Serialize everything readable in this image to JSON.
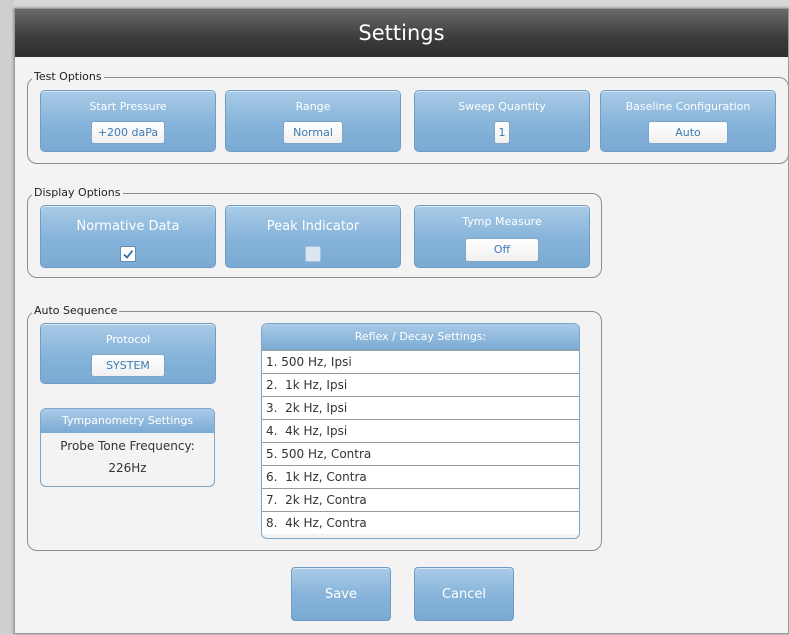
{
  "window": {
    "title": "Settings"
  },
  "test_options": {
    "label": "Test Options",
    "tiles": [
      {
        "title": "Start Pressure",
        "value": "+200 daPa"
      },
      {
        "title": "Range",
        "value": "Normal"
      },
      {
        "title": "Sweep Quantity",
        "value": "1"
      },
      {
        "title": "Baseline Configuration",
        "value": "Auto"
      }
    ]
  },
  "display_options": {
    "label": "Display Options",
    "normative_data": {
      "title": "Normative Data",
      "checked": true
    },
    "peak_indicator": {
      "title": "Peak Indicator",
      "checked": false
    },
    "tymp_measure": {
      "title": "Tymp Measure",
      "value": "Off"
    }
  },
  "auto_sequence": {
    "label": "Auto Sequence",
    "protocol": {
      "title": "Protocol",
      "value": "SYSTEM"
    },
    "tympanometry": {
      "title": "Tympanometry Settings",
      "label": "Probe Tone Frequency:",
      "value": "226Hz"
    },
    "reflex": {
      "title": "Reflex / Decay Settings:",
      "items": [
        "1. 500 Hz, Ipsi",
        "2.  1k Hz, Ipsi",
        "3.  2k Hz, Ipsi",
        "4.  4k Hz, Ipsi",
        "5. 500 Hz, Contra",
        "6.  1k Hz, Contra",
        "7.  2k Hz, Contra",
        "8.  4k Hz, Contra"
      ]
    }
  },
  "actions": {
    "save": "Save",
    "cancel": "Cancel"
  },
  "colors": {
    "accent": "#86b3d9",
    "title_bar": "#3c3c3c",
    "value_text": "#3b7ab5"
  }
}
